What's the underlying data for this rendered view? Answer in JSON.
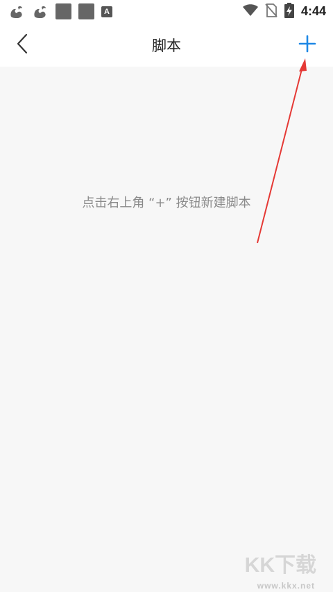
{
  "status_bar": {
    "time": "4:44",
    "left_icons": [
      "squirrel-icon",
      "squirrel-icon",
      "gray-square-icon",
      "gray-square-icon",
      "a-letter-icon"
    ],
    "a_letter": "A",
    "right_icons": [
      "wifi-icon",
      "no-sim-icon",
      "battery-charging-icon"
    ]
  },
  "app_bar": {
    "title": "脚本",
    "back_icon": "chevron-left-icon",
    "add_icon": "plus-icon",
    "accent_color": "#1e88e5"
  },
  "content": {
    "empty_hint": "点击右上角 “+” 按钮新建脚本"
  },
  "annotation": {
    "arrow_color": "#e53935"
  },
  "watermark": {
    "logo": "KK下载",
    "url": "www.kkx.net"
  }
}
